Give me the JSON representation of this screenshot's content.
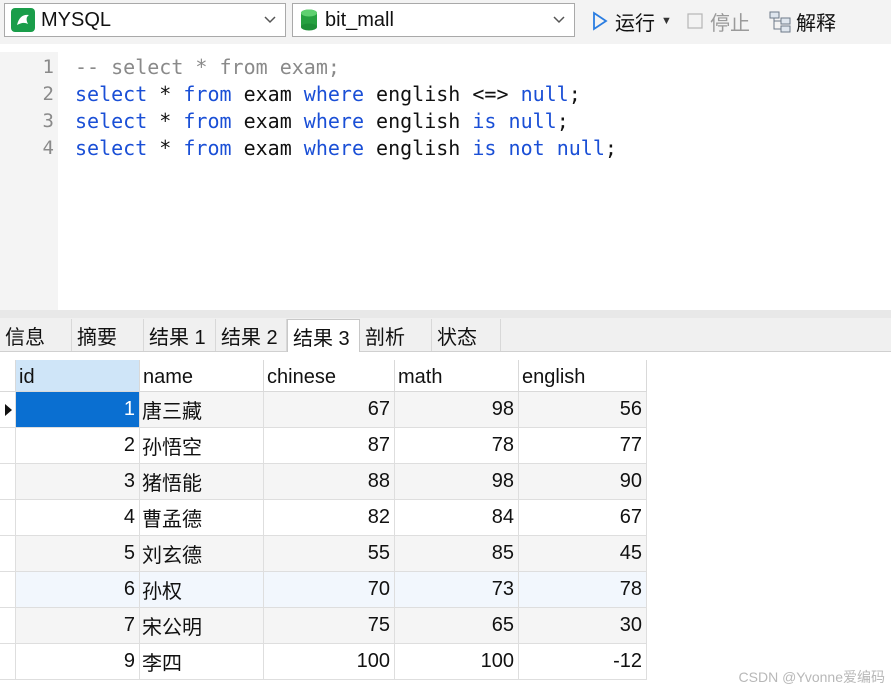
{
  "toolbar": {
    "connection": "MYSQL",
    "database": "bit_mall",
    "run_label": "运行",
    "stop_label": "停止",
    "explain_label": "解释"
  },
  "editor": {
    "line_numbers": [
      "1",
      "2",
      "3",
      "4"
    ],
    "lines": [
      [
        {
          "t": "-- select * from exam;",
          "c": "cm"
        }
      ],
      [
        {
          "t": "select",
          "c": "kw"
        },
        {
          "t": " * ",
          "c": ""
        },
        {
          "t": "from",
          "c": "kw"
        },
        {
          "t": " exam ",
          "c": ""
        },
        {
          "t": "where",
          "c": "kw"
        },
        {
          "t": " english <=> ",
          "c": ""
        },
        {
          "t": "null",
          "c": "kw"
        },
        {
          "t": ";",
          "c": ""
        }
      ],
      [
        {
          "t": "select",
          "c": "kw"
        },
        {
          "t": " * ",
          "c": ""
        },
        {
          "t": "from",
          "c": "kw"
        },
        {
          "t": " exam ",
          "c": ""
        },
        {
          "t": "where",
          "c": "kw"
        },
        {
          "t": " english ",
          "c": ""
        },
        {
          "t": "is",
          "c": "kw"
        },
        {
          "t": " ",
          "c": ""
        },
        {
          "t": "null",
          "c": "kw"
        },
        {
          "t": ";",
          "c": ""
        }
      ],
      [
        {
          "t": "select",
          "c": "kw"
        },
        {
          "t": " * ",
          "c": ""
        },
        {
          "t": "from",
          "c": "kw"
        },
        {
          "t": " exam ",
          "c": ""
        },
        {
          "t": "where",
          "c": "kw"
        },
        {
          "t": " english ",
          "c": ""
        },
        {
          "t": "is",
          "c": "kw"
        },
        {
          "t": " ",
          "c": ""
        },
        {
          "t": "not",
          "c": "kw"
        },
        {
          "t": " ",
          "c": ""
        },
        {
          "t": "null",
          "c": "kw"
        },
        {
          "t": ";",
          "c": ""
        }
      ]
    ]
  },
  "result_tabs": [
    "信息",
    "摘要",
    "结果 1",
    "结果 2",
    "结果 3",
    "剖析",
    "状态"
  ],
  "active_tab": "结果 3",
  "grid": {
    "columns": [
      "id",
      "name",
      "chinese",
      "math",
      "english"
    ],
    "rows": [
      [
        "1",
        "唐三藏",
        "67",
        "98",
        "56"
      ],
      [
        "2",
        "孙悟空",
        "87",
        "78",
        "77"
      ],
      [
        "3",
        "猪悟能",
        "88",
        "98",
        "90"
      ],
      [
        "4",
        "曹孟德",
        "82",
        "84",
        "67"
      ],
      [
        "5",
        "刘玄德",
        "55",
        "85",
        "45"
      ],
      [
        "6",
        "孙权",
        "70",
        "73",
        "78"
      ],
      [
        "7",
        "宋公明",
        "75",
        "65",
        "30"
      ],
      [
        "9",
        "李四",
        "100",
        "100",
        "-12"
      ]
    ]
  },
  "watermark": "CSDN @Yvonne爱编码",
  "colors": {
    "keyword": "#1a4fd6",
    "comment": "#8a8a8a",
    "selection": "#0a6fd1",
    "header_selected": "#cfe5f8",
    "connection_icon": "#1a9d4a"
  }
}
